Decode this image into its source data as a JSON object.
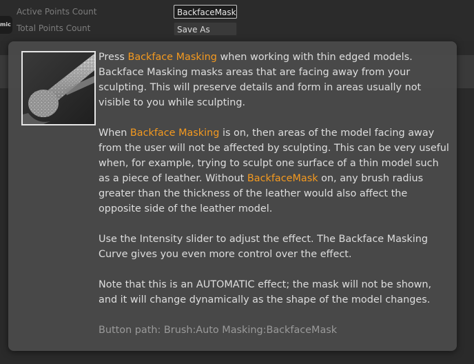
{
  "background": {
    "rows": [
      {
        "label": "Active Points Count",
        "field": "BackfaceMask"
      },
      {
        "label": "Total Points Count",
        "field": "Save As"
      }
    ],
    "left_tab_label": "mic"
  },
  "tooltip": {
    "p1": {
      "a": "Press ",
      "hl": "Backface Masking",
      "b": " when working with thin edged models. Backface Masking masks areas that are facing away from your sculpting.  This will preserve details and form in areas usually not visible to you while sculpting."
    },
    "p2": {
      "a": "When ",
      "hl1": "Backface Masking",
      "b": " is on, then areas of the model facing away from the user will not be affected by sculpting. This can be very useful when, for example, trying to sculpt one surface of a thin model such as a piece of leather. Without ",
      "hl2": "BackfaceMask",
      "c": " on, any brush radius greater than the thickness of the leather would also affect the opposite side of the leather model."
    },
    "p3": "Use the Intensity slider to adjust the effect.  The Backface Masking Curve gives you even more control over the effect.",
    "p4": "Note that this is an AUTOMATIC effect; the mask will not be shown, and it will change dynamically as the shape of the model changes.",
    "button_path": "Button path: Brush:Auto Masking:BackfaceMask"
  },
  "colors": {
    "highlight": "#f59a1f",
    "text": "#dedede",
    "path_text": "#9a9a9a",
    "tooltip_bg": "#4a4a4a"
  }
}
